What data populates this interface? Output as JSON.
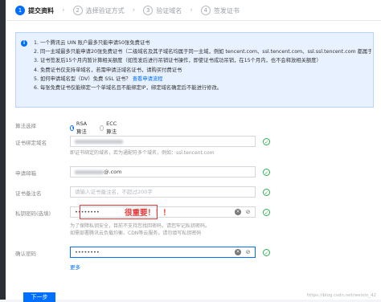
{
  "steps": [
    {
      "num": "1",
      "label": "提交资料"
    },
    {
      "num": "2",
      "label": "选择验证方式"
    },
    {
      "num": "3",
      "label": "验证域名"
    },
    {
      "num": "4",
      "label": "签发证书"
    }
  ],
  "notice": {
    "items": [
      "1. 一个腾讯云 UIN 账户最多只能申请50张免费证书",
      "2. 同一主域最多只能申请20张免费证书（二级域名及其子域名均属于同一主域，例如 tencent.com、ssl.tencent.com、ssl.ssl.tencent.com 都属于同一主域）",
      "3. 证书签发后15个月内暂计算相关额度（如签发后进行吊销证书操作，即使证书成功吊销，在15个月内，也不会释放相关额度）",
      "4. 免费证书仅支持单域名，若需申请泛域名证书，请购买付费证书",
      "5. 如何申请域名型（DV）免费 SSL 证书？",
      "6. 每张免费证书仅能绑定一个单域名且不能绑定IP，绑定域名确定后不能进行修改。"
    ],
    "guide_link": "查看申请流程"
  },
  "form": {
    "algorithm": {
      "label": "算法选择",
      "options": [
        "RSA算法",
        "ECC算法"
      ],
      "selected": "RSA算法"
    },
    "domain": {
      "label": "证书绑定域名",
      "hint": "即证书绑定的域名，若为通配符多个域名，例如：ssl.tencent.com"
    },
    "email": {
      "label": "申请邮箱",
      "value_suffix": "@.com"
    },
    "remark": {
      "label": "证书备注名",
      "placeholder": "请输入证书备注名，不超过200字"
    },
    "private_key": {
      "label": "私钥密码(选填)",
      "value": "••••••••",
      "hint1": "为了保障私钥安全，目前不支持您找回密码，请您牢记私钥密码。",
      "hint2": "如需部署腾讯云负载均衡、CDN等云服务，请勿填写私钥密码"
    },
    "confirm": {
      "label": "确认密码",
      "value": "••••••••"
    },
    "more": "更多"
  },
  "annotation": "很重要！！！",
  "next_button": "下一步",
  "watermark": "https://blog.csdn.net/weixin_42"
}
